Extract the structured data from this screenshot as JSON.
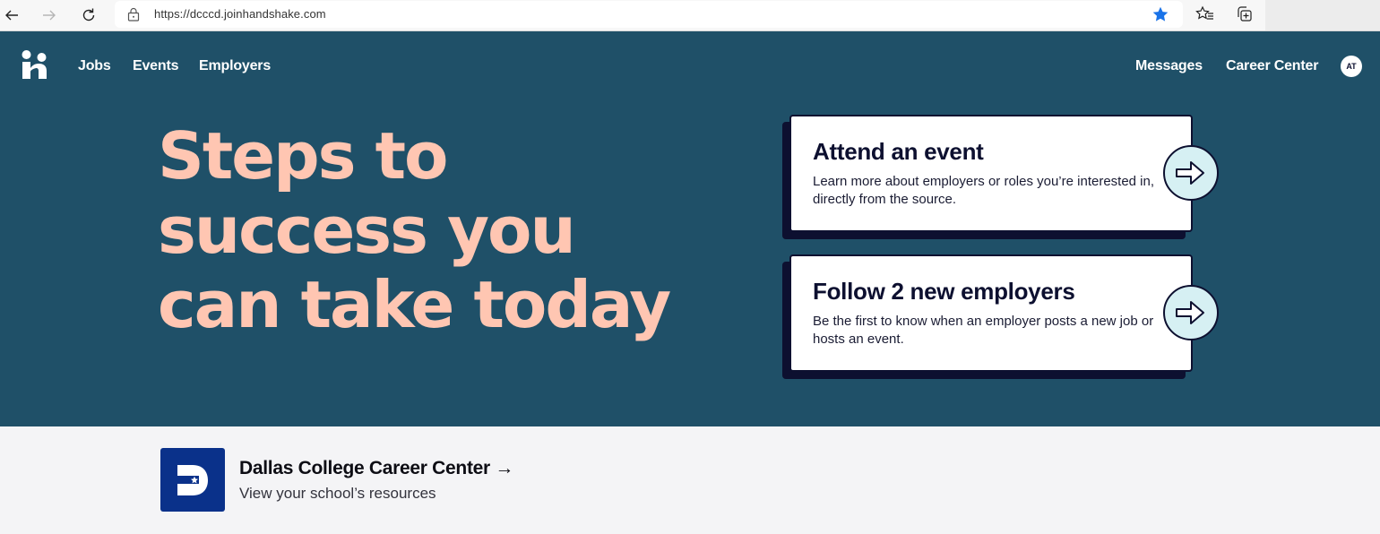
{
  "browser": {
    "url": "https://dcccd.joinhandshake.com",
    "back_icon": "arrow-left-icon",
    "forward_icon": "arrow-right-icon",
    "reload_icon": "reload-icon",
    "lock_icon": "lock-icon",
    "favorite_icon": "star-filled-icon",
    "favorites_list_icon": "favorites-list-icon",
    "collections_icon": "collections-icon",
    "accent_color": "#1a73e8"
  },
  "nav": {
    "logo_icon": "handshake-logo-icon",
    "left_links": [
      "Jobs",
      "Events",
      "Employers"
    ],
    "right_links": [
      "Messages",
      "Career Center"
    ],
    "avatar_initials": "AT"
  },
  "hero": {
    "background_color": "#1f5068",
    "headline_lines": [
      "Steps to",
      "success you",
      "can take today"
    ],
    "headline_color": "#ffc6b2",
    "cards": [
      {
        "title": "Attend an event",
        "description": "Learn more about employers or roles you’re interested in, directly from the source.",
        "arrow_icon": "arrow-right-circle-icon"
      },
      {
        "title": "Follow 2 new employers",
        "description": "Be the first to know when an employer posts a new job or hosts an event.",
        "arrow_icon": "arrow-right-circle-icon"
      }
    ]
  },
  "school": {
    "logo_icon": "dallas-college-logo-icon",
    "title": "Dallas College Career Center →",
    "subtitle": "View your school’s resources",
    "logo_color": "#0a318a"
  }
}
